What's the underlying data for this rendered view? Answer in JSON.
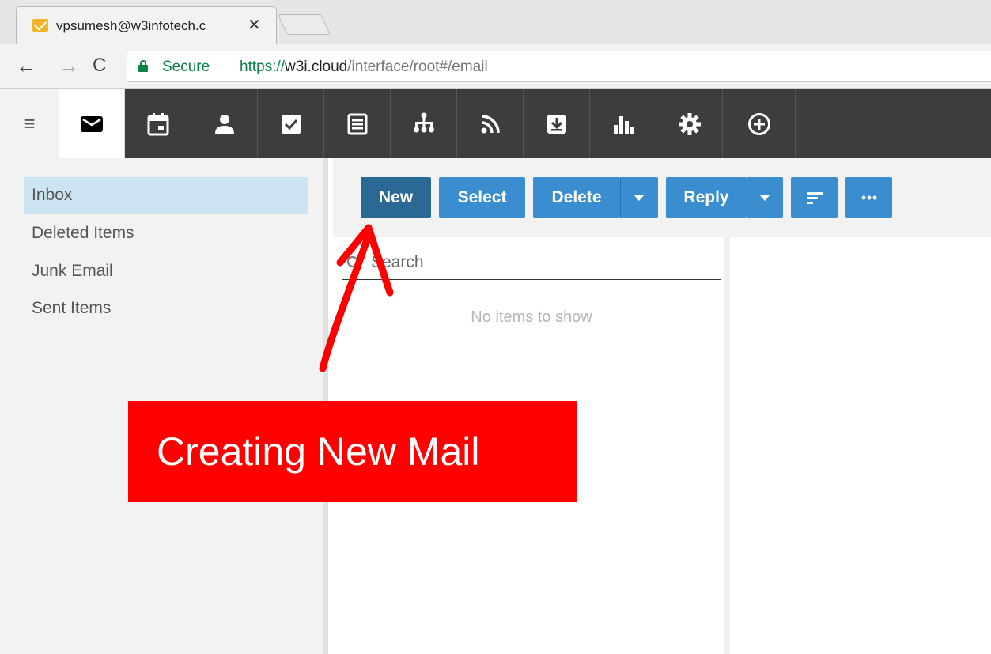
{
  "browser": {
    "tab_title": "vpsumesh@w3infotech.c",
    "close_glyph": "✕",
    "back_glyph": "←",
    "forward_glyph": "→",
    "reload_glyph": "C",
    "secure_label": "Secure",
    "url_scheme": "https://",
    "url_host": "w3i.cloud",
    "url_path": "/interface/root#/email"
  },
  "app": {
    "menu_glyph": "≡",
    "nav_icons": [
      "mail-icon",
      "calendar-icon",
      "contacts-icon",
      "tasks-icon",
      "notes-icon",
      "organization-icon",
      "rss-icon",
      "download-icon",
      "reports-icon",
      "settings-icon",
      "add-icon"
    ]
  },
  "folders": [
    {
      "label": "Inbox",
      "selected": true
    },
    {
      "label": "Deleted Items",
      "selected": false
    },
    {
      "label": "Junk Email",
      "selected": false
    },
    {
      "label": "Sent Items",
      "selected": false
    }
  ],
  "actions": {
    "new_label": "New",
    "select_label": "Select",
    "delete_label": "Delete",
    "reply_label": "Reply",
    "sort_icon": "sort-icon",
    "more_icon": "more-icon"
  },
  "list": {
    "search_placeholder": "Search",
    "empty_message": "No items to show"
  },
  "annotation": {
    "text": "Creating New Mail"
  },
  "colors": {
    "accent": "#3a8dce",
    "primary_button": "#2a6896",
    "toolbar": "#3d3d3d",
    "annotation": "#ff0000",
    "secure": "#0b8043"
  }
}
